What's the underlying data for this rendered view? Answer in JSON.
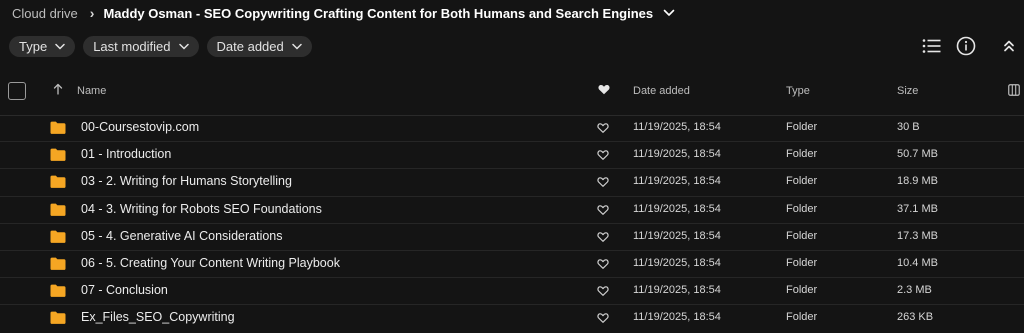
{
  "breadcrumb": {
    "root": "Cloud drive",
    "current": "Maddy Osman - SEO Copywriting Crafting Content for Both Humans and Search Engines"
  },
  "filters": [
    {
      "label": "Type"
    },
    {
      "label": "Last modified"
    },
    {
      "label": "Date added"
    }
  ],
  "icons": {
    "list_view": "list-view-icon",
    "info": "info-icon",
    "collapse": "chevrons-up-icon",
    "columns": "columns-icon",
    "favourite": "heart-icon",
    "folder": "folder-icon"
  },
  "colors": {
    "background": "#141414",
    "folder": "#f5a623",
    "chip": "#2e2e2e"
  },
  "table": {
    "columns": {
      "name": "Name",
      "date_added": "Date added",
      "type": "Type",
      "size": "Size"
    },
    "rows": [
      {
        "name": "00-Coursestovip.com",
        "date": "11/19/2025, 18:54",
        "type": "Folder",
        "size": "30 B"
      },
      {
        "name": "01 - Introduction",
        "date": "11/19/2025, 18:54",
        "type": "Folder",
        "size": "50.7 MB"
      },
      {
        "name": "03 - 2. Writing for Humans Storytelling",
        "date": "11/19/2025, 18:54",
        "type": "Folder",
        "size": "18.9 MB"
      },
      {
        "name": "04 - 3. Writing for Robots SEO Foundations",
        "date": "11/19/2025, 18:54",
        "type": "Folder",
        "size": "37.1 MB"
      },
      {
        "name": "05 - 4. Generative AI Considerations",
        "date": "11/19/2025, 18:54",
        "type": "Folder",
        "size": "17.3 MB"
      },
      {
        "name": "06 - 5. Creating Your Content Writing Playbook",
        "date": "11/19/2025, 18:54",
        "type": "Folder",
        "size": "10.4 MB"
      },
      {
        "name": "07 - Conclusion",
        "date": "11/19/2025, 18:54",
        "type": "Folder",
        "size": "2.3 MB"
      },
      {
        "name": "Ex_Files_SEO_Copywriting",
        "date": "11/19/2025, 18:54",
        "type": "Folder",
        "size": "263 KB"
      }
    ]
  }
}
